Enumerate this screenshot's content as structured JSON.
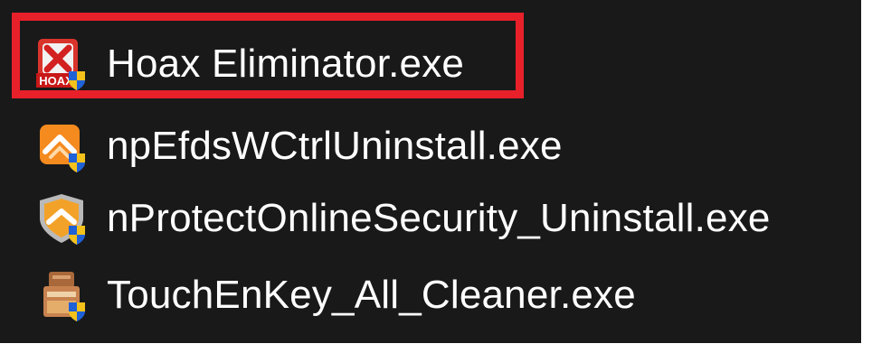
{
  "files": [
    {
      "name": "Hoax Eliminator.exe",
      "icon": "hoax-eliminator-icon"
    },
    {
      "name": "npEfdsWCtrlUninstall.exe",
      "icon": "npefds-uninstall-icon"
    },
    {
      "name": "nProtectOnlineSecurity_Uninstall.exe",
      "icon": "nprotect-security-shield-icon"
    },
    {
      "name": "TouchEnKey_All_Cleaner.exe",
      "icon": "touchenkey-cleaner-icon"
    }
  ],
  "icon_badge_text": "HOAX",
  "highlight": {
    "color": "#e8202a",
    "target": "Hoax Eliminator.exe"
  },
  "colors": {
    "background": "#191919",
    "text": "#ffffff"
  }
}
